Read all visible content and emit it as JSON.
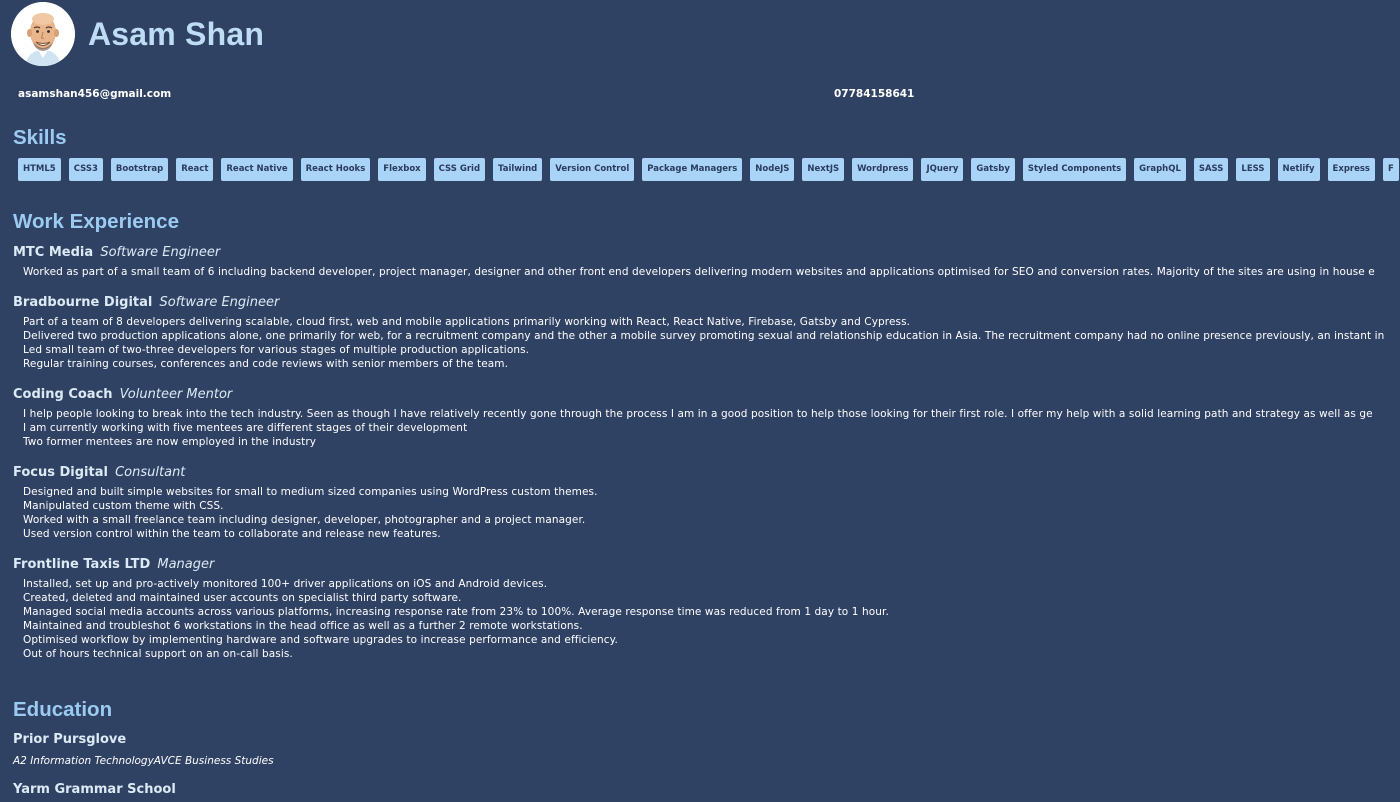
{
  "profile": {
    "name": "Asam Shan",
    "email": "asamshan456@gmail.com",
    "phone": "07784158641",
    "avatar_icon": "cartoon-avatar-icon"
  },
  "skills": {
    "title": "Skills",
    "items": [
      "HTML5",
      "CSS3",
      "Bootstrap",
      "React",
      "React Native",
      "React Hooks",
      "Flexbox",
      "CSS Grid",
      "Tailwind",
      "Version Control",
      "Package Managers",
      "NodeJS",
      "NextJS",
      "Wordpress",
      "JQuery",
      "Gatsby",
      "Styled Components",
      "GraphQL",
      "SASS",
      "LESS",
      "Netlify",
      "Express",
      "F"
    ]
  },
  "experience": {
    "title": "Work Experience",
    "jobs": [
      {
        "company": "MTC Media",
        "role": "Software Engineer",
        "bullets": [
          "Worked as part of a small team of 6 including backend developer, project manager, designer and other front end developers delivering modern websites and applications optimised for SEO and conversion rates. Majority of the sites are using in house e"
        ]
      },
      {
        "company": "Bradbourne Digital",
        "role": "Software Engineer",
        "bullets": [
          "Part of a team of 8 developers delivering scalable, cloud first, web and mobile applications primarily working with React, React Native, Firebase, Gatsby and Cypress.",
          "Delivered two production applications alone, one primarily for web, for a recruitment company and the other a mobile survey promoting sexual and relationship education in Asia. The recruitment company had no online presence previously, an instant in",
          "Led small team of two-three developers for various stages of multiple production applications.",
          "Regular training courses, conferences and code reviews with senior members of the team."
        ]
      },
      {
        "company": "Coding Coach",
        "role": "Volunteer Mentor",
        "bullets": [
          "I help people looking to break into the tech industry. Seen as though I have relatively recently gone through the process I am in a good position to help those looking for their first role. I offer my help with a solid learning path and strategy as well as ge",
          "I am currently working with five mentees are different stages of their development",
          "Two former mentees are now employed in the industry"
        ]
      },
      {
        "company": "Focus Digital",
        "role": "Consultant",
        "bullets": [
          "Designed and built simple websites for small to medium sized companies using WordPress custom themes.",
          "Manipulated custom theme with CSS.",
          "Worked with a small freelance team including designer, developer, photographer and a project manager.",
          "Used version control within the team to collaborate and release new features."
        ]
      },
      {
        "company": "Frontline Taxis LTD",
        "role": "Manager",
        "bullets": [
          "Installed, set up and pro-actively monitored 100+ driver applications on iOS and Android devices.",
          "Created, deleted and maintained user accounts on specialist third party software.",
          "Managed social media accounts across various platforms, increasing response rate from 23% to 100%. Average response time was reduced from 1 day to 1 hour.",
          "Maintained and troubleshot 6 workstations in the head office as well as a further 2 remote workstations.",
          "Optimised workflow by implementing hardware and software upgrades to increase performance and efficiency.",
          "Out of hours technical support on an on-call basis."
        ]
      }
    ]
  },
  "education": {
    "title": "Education",
    "schools": [
      {
        "name": "Prior Pursglove",
        "qualification": "A2 Information TechnologyAVCE Business Studies"
      },
      {
        "name": "Yarm Grammar School",
        "qualification": ""
      }
    ]
  },
  "colors": {
    "background": "#304264",
    "heading": "#9ccbf1",
    "name": "#bfdcf5",
    "skill_chip": "#aad4f7",
    "skill_text": "#2a3b5c"
  }
}
